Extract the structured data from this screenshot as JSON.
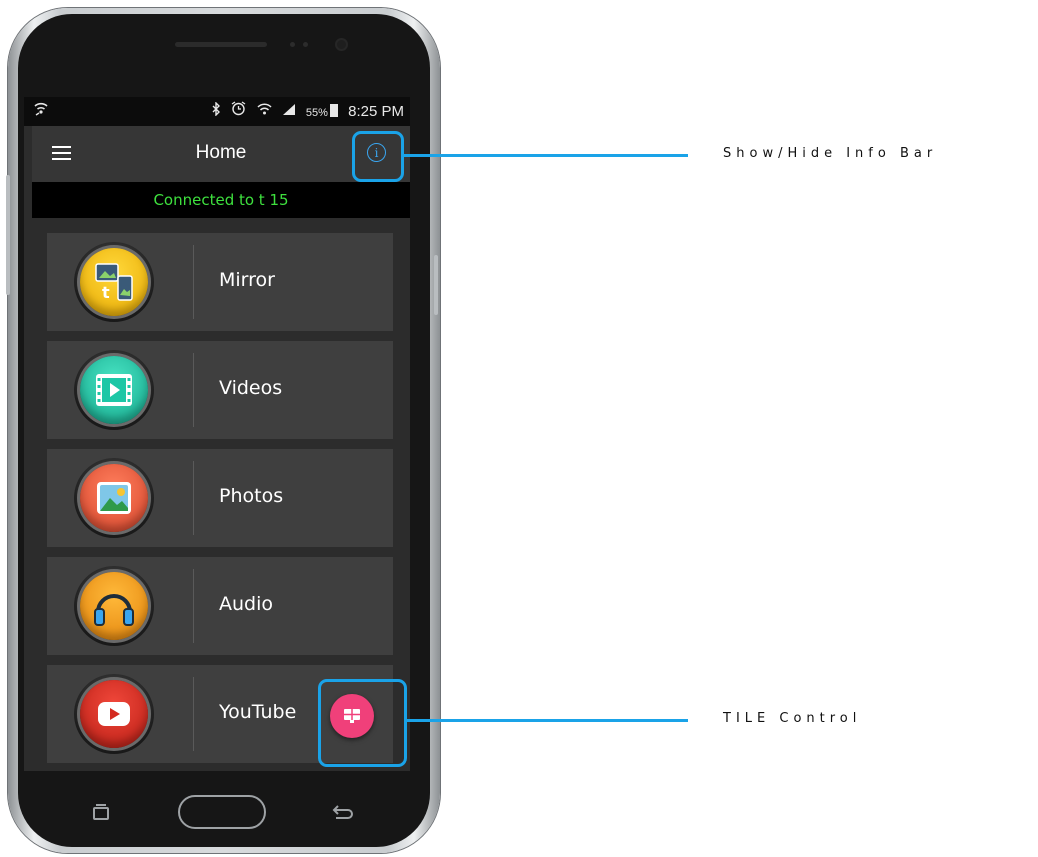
{
  "status_bar": {
    "battery_percent": "55%",
    "time": "8:25 PM",
    "icons": [
      "wifi-call-icon",
      "bluetooth-icon",
      "alarm-icon",
      "wifi-icon",
      "signal-icon",
      "battery-icon"
    ]
  },
  "app_bar": {
    "title": "Home",
    "menu_icon": "hamburger-menu-icon",
    "info_icon": "info-icon"
  },
  "info_bar": {
    "text": "Connected to t 15"
  },
  "menu_items": [
    {
      "label": "Mirror",
      "icon": "mirror-icon",
      "color": "#f2b705"
    },
    {
      "label": "Videos",
      "icon": "videos-icon",
      "color": "#1cc7a6"
    },
    {
      "label": "Photos",
      "icon": "photos-icon",
      "color": "#ee5a3c"
    },
    {
      "label": "Audio",
      "icon": "audio-icon",
      "color": "#f39a12"
    },
    {
      "label": "YouTube",
      "icon": "youtube-icon",
      "color": "#d42a20"
    }
  ],
  "fab": {
    "icon": "tile-control-icon",
    "color": "#f0407a"
  },
  "callouts": {
    "info": "Show/Hide Info Bar",
    "tile": "TILE Control",
    "color": "#1aa3e8"
  },
  "nav_keys": [
    "recent-apps-icon",
    "home-key",
    "back-icon"
  ]
}
